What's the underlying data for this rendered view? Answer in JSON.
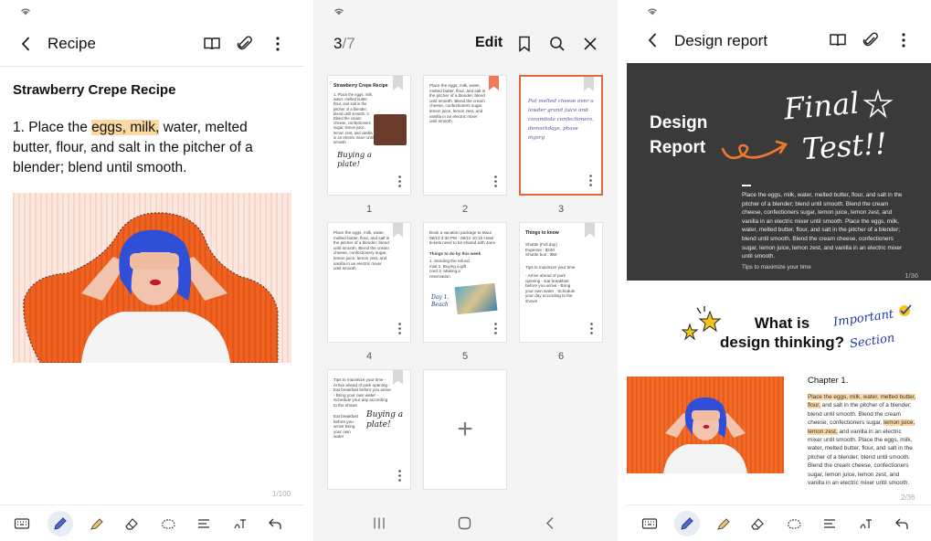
{
  "panel1": {
    "title": "Recipe",
    "note_heading": "Strawberry Crepe Recipe",
    "note_text_before": "1. Place the ",
    "note_highlight": "eggs, milk,",
    "note_text_after": " water, melted butter, flour, and salt in the pitcher of a blender; blend until smooth.",
    "page_indicator": "1/100"
  },
  "panel2": {
    "page_current": "3",
    "page_total": "/7",
    "edit_label": "Edit",
    "thumbnails": [
      {
        "label": "1",
        "title": "Strawberry Crepe Recipe",
        "text": "1. Place the eggs, milk, water, melted butter, flour, and salt in the pitcher of a blender; blend until smooth. 2. Blend the cream cheese, confectioners sugar, lemon juice, lemon zest, and vanilla in an electric mixer until smooth",
        "handwriting": "Buying a plate!"
      },
      {
        "label": "2",
        "text": "Place the eggs, milk, water, melted butter, flour, and salt in the pitcher of a blender; blend until smooth. Blend the cream cheese, confectioners sugar, lemon juice, lemon zest, and vanilla in an electric mixer until smooth"
      },
      {
        "label": "3",
        "handwriting": "Put melted cheese over a lowder grand juice and carambola confectioners, demarkdays, phase ingsrg"
      },
      {
        "label": "4",
        "text": "Place the eggs, milk, water, melted butter, flour, and salt in the pitcher of a blender; blend until smooth. Blend the cream cheese, confectionery sugar, lemon juice, lemon zest, and vanilla in an electric mixer until smooth"
      },
      {
        "label": "5",
        "text": "Book a vacation package to Maui 08/10 3:30 PM - 09/10 10:15 Hotel tickets need to be shared with Jane",
        "subhead": "Things to do by this week",
        "list": "1. Sending the refund mail 2. Buying a gift card 3. Making a reservation",
        "handwriting": "Day 1. Beach"
      },
      {
        "label": "6",
        "title": "Things to know",
        "text": "Shuttle (Full day) Expense : $240 Shuttle bus : $50",
        "subhead": "Tips to maximize your time",
        "list": "- Arrive ahead of park opening - Eat breakfast before you arrive - Bring your own water - Schedule your day according to the shows"
      },
      {
        "label": "7",
        "text": "Tips to maximize your time - Arrive ahead of park opening - Eat breakfast before you arrive - Bring your own water - Schedule your day according to the shows",
        "extra": "Eat breakfast before you arrive Bring your own water",
        "handwriting": "Buying a plate!"
      }
    ],
    "add_label": "+"
  },
  "panel3": {
    "title": "Design report",
    "slide_title_line1": "Design",
    "slide_title_line2": "Report",
    "slide_handwriting_1": "Final",
    "slide_handwriting_2": "Test!!",
    "slide_body": "Place the eggs, milk, water, melted butter, flour, and salt in the pitcher of a blender; blend until smooth. Blend the cream cheese, confectioners sugar, lemon juice, lemon zest, and vanilla in an electric mixer until smooth. Place the eggs, milk, water, melted butter, flour, and salt in the pitcher of a blender; blend until smooth. Blend the cream cheese, confectioners sugar, lemon juice, lemon zest, and vanilla in an electric mixer until smooth.",
    "slide_sub": "Tips to maximize your time",
    "slide_page": "1/36",
    "dt_title_line1": "What is",
    "dt_title_line2": "design thinking?",
    "dt_handwriting_1": "Important",
    "dt_handwriting_2": "Section",
    "chapter": "Chapter 1.",
    "dt_body_highlight_1": "Place the eggs, milk, water, melted butter, flour,",
    "dt_body_1": " and salt in the pitcher of a blender; blend until smooth. Blend the cream cheese, confectioners sugar, ",
    "dt_body_highlight_2": "lemon juice, lemon zest,",
    "dt_body_2": " and vanilla in an electric mixer until smooth. Place the eggs, milk, water, melted butter, flour, and salt in the pitcher of a blender; blend until smooth. Blend the cream cheese, confectioners sugar, lemon juice, lemon zest, and vanilla in an electric mixer until smooth.",
    "page_indicator": "2/36"
  },
  "colors": {
    "accent_orange": "#e8643c",
    "highlight": "#fbd9a5",
    "pen_blue": "#4a6fd0"
  }
}
